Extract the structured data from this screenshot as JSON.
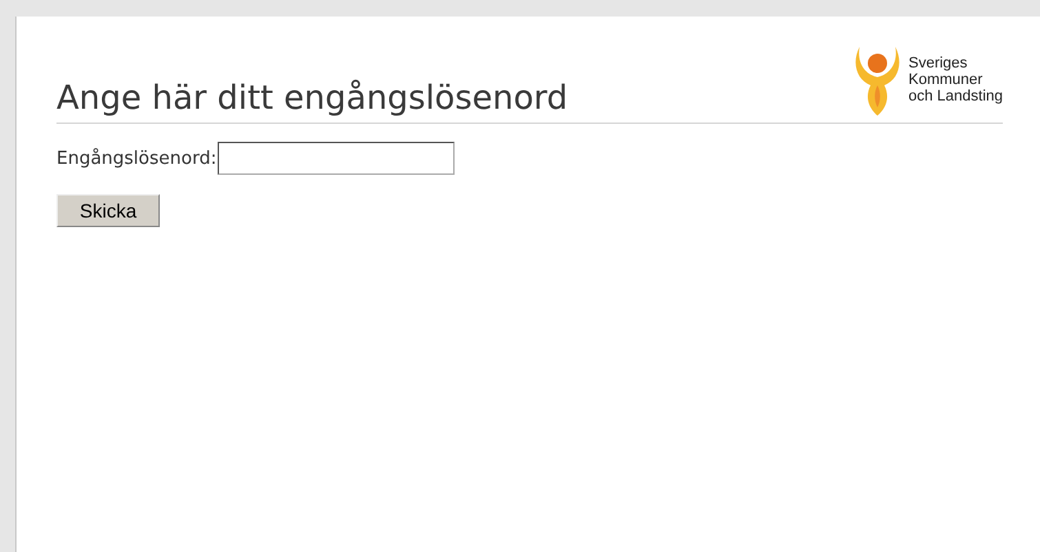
{
  "heading": "Ange här ditt engångslösenord",
  "logo": {
    "lines": [
      "Sveriges",
      "Kommuner",
      "och Landsting"
    ]
  },
  "field": {
    "label": "Engångslösenord:"
  },
  "buttons": [
    "Skicka"
  ]
}
